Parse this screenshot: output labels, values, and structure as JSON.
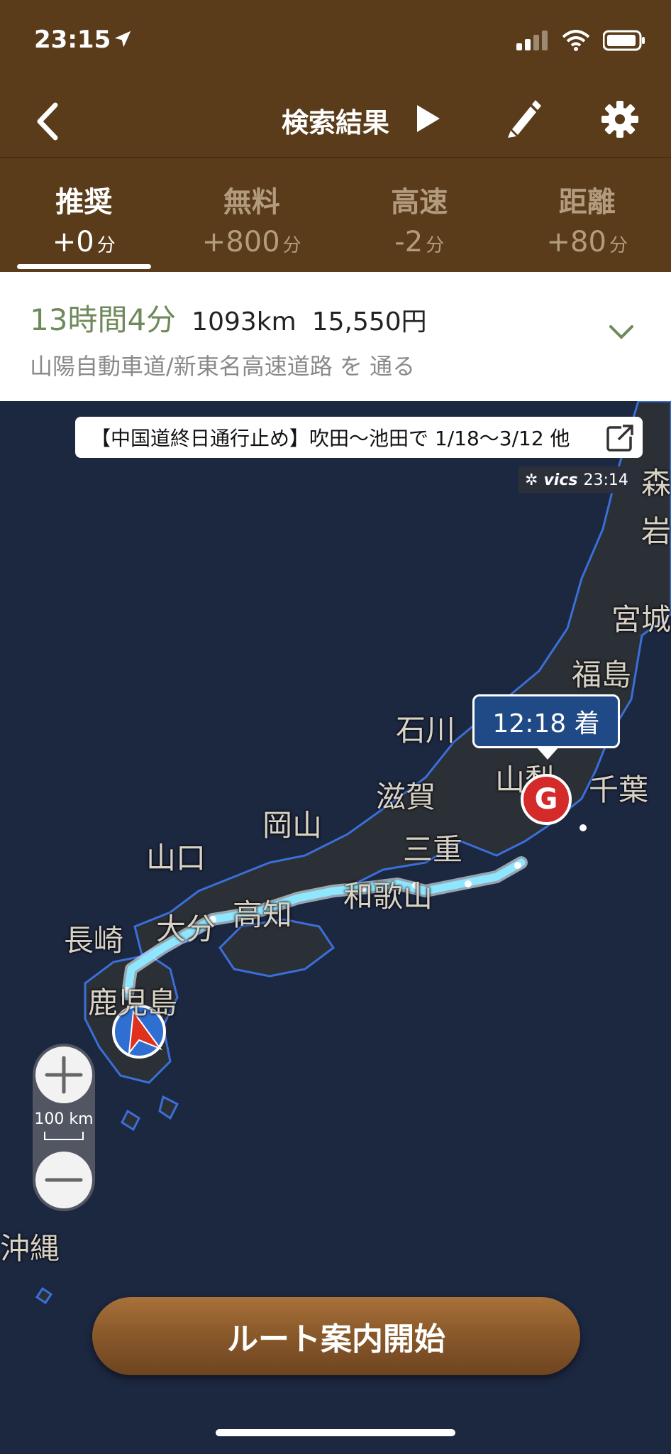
{
  "status": {
    "time": "23:15"
  },
  "nav": {
    "title": "検索結果"
  },
  "tabs": [
    {
      "label": "推奨",
      "delta": "+0",
      "unit": "分",
      "active": true
    },
    {
      "label": "無料",
      "delta": "+800",
      "unit": "分"
    },
    {
      "label": "高速",
      "delta": "-2",
      "unit": "分"
    },
    {
      "label": "距離",
      "delta": "+80",
      "unit": "分"
    }
  ],
  "summary": {
    "duration": "13時間4分",
    "distance": "1093km",
    "toll": "15,550円",
    "roads": "山陽自動車道/新東名高速道路 を 通る"
  },
  "map": {
    "notice": "【中国道終日通行止め】吹田～池田で 1/18～3/12 他",
    "vics_label": "vics",
    "vics_time": "23:14",
    "eta": "12:18 着",
    "goal_marker": "G",
    "scale": "100 km",
    "prefectures": {
      "shiga": "滋賀",
      "ishikawa": "石川",
      "yamanashi": "山梨",
      "chiba": "千葉",
      "fukushima": "福島",
      "miyagi": "宮城",
      "iwate": "岩",
      "aomori": "森",
      "okayama": "岡山",
      "yamaguchi": "山口",
      "mie": "三重",
      "wakayama": "和歌山",
      "kochi": "高知",
      "nagasaki": "長崎",
      "oita": "大分",
      "kagoshima": "鹿児島",
      "okinawa": "沖縄"
    }
  },
  "start_button": "ルート案内開始",
  "colors": {
    "header": "#5a3c1a",
    "map_bg": "#1c2740",
    "route": "#a8ecff",
    "accent_green": "#6f8a5a"
  }
}
